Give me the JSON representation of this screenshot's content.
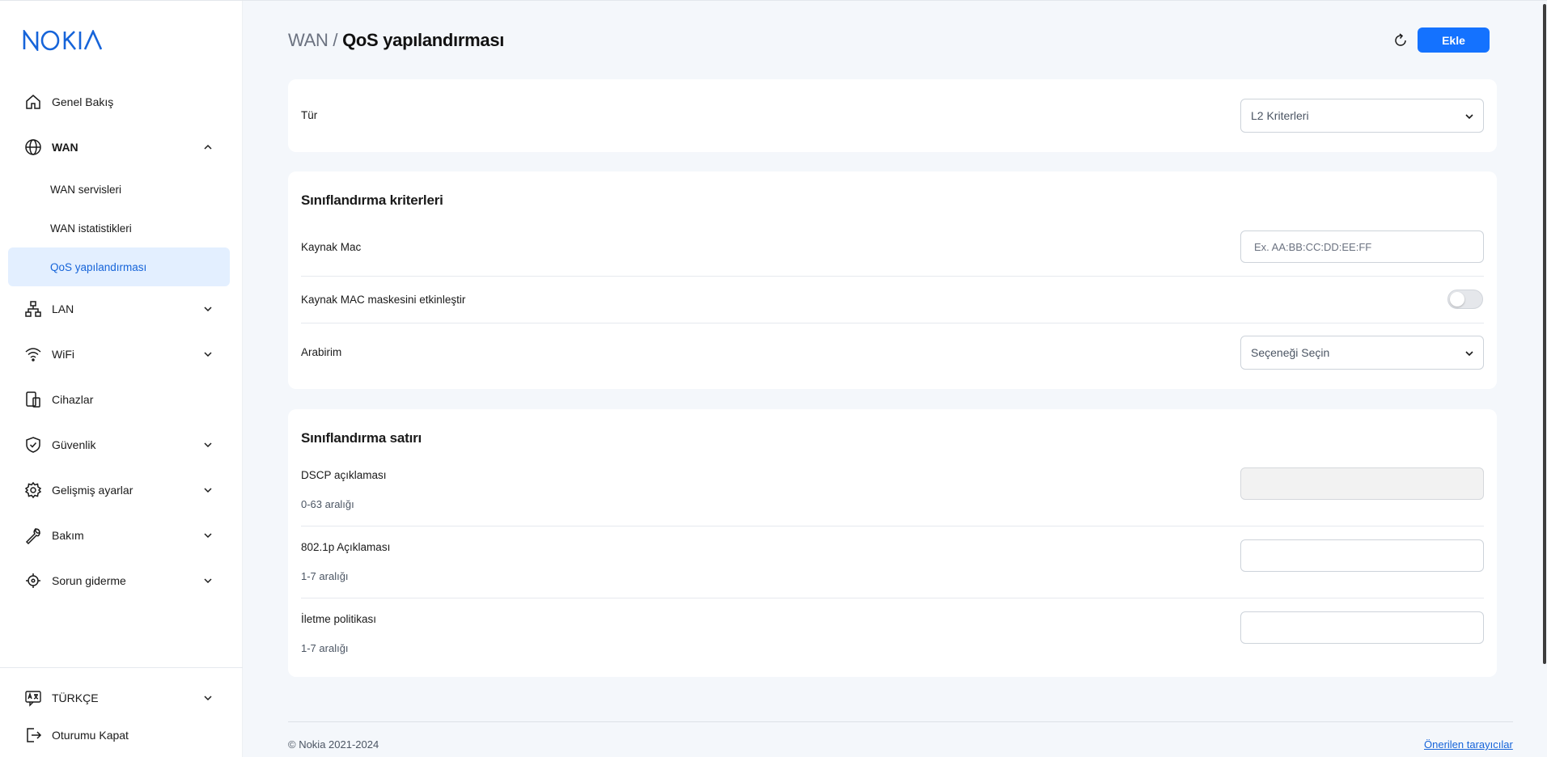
{
  "brand": {
    "logo_text": "NOKIA",
    "accent": "#1472ff",
    "active_bg": "#e3efff"
  },
  "sidebar": {
    "items": [
      {
        "label": "Genel Bakış",
        "icon": "home-icon"
      },
      {
        "label": "WAN",
        "icon": "globe-icon",
        "expanded": true
      },
      {
        "label": "LAN",
        "icon": "network-icon"
      },
      {
        "label": "WiFi",
        "icon": "wifi-icon"
      },
      {
        "label": "Cihazlar",
        "icon": "devices-icon"
      },
      {
        "label": "Güvenlik",
        "icon": "shield-icon"
      },
      {
        "label": "Gelişmiş ayarlar",
        "icon": "gear-icon"
      },
      {
        "label": "Bakım",
        "icon": "wrench-icon"
      },
      {
        "label": "Sorun giderme",
        "icon": "crosshair-icon"
      }
    ],
    "wan_sub": [
      {
        "label": "WAN servisleri"
      },
      {
        "label": "WAN istatistikleri"
      },
      {
        "label": "QoS yapılandırması",
        "active": true
      }
    ],
    "language": "TÜRKÇE",
    "logout": "Oturumu Kapat"
  },
  "header": {
    "breadcrumb_parent": "WAN /",
    "breadcrumb_current": "QoS yapılandırması",
    "add_label": "Ekle"
  },
  "type_card": {
    "label": "Tür",
    "value": "L2 Kriterleri"
  },
  "criteria": {
    "title": "Sınıflandırma kriterleri",
    "source_mac_label": "Kaynak Mac",
    "source_mac_placeholder": "Ex. AA:BB:CC:DD:EE:FF",
    "mac_mask_label": "Kaynak MAC maskesini etkinleştir",
    "mac_mask_enabled": false,
    "interface_label": "Arabirim",
    "interface_value": "Seçeneği Seçin"
  },
  "classification_row": {
    "title": "Sınıflandırma satırı",
    "dscp_label": "DSCP açıklaması",
    "dscp_hint": "0-63 aralığı",
    "dot1p_label": "802.1p Açıklaması",
    "dot1p_hint": "1-7 aralığı",
    "forward_label": "İletme politikası",
    "forward_hint": "1-7 aralığı"
  },
  "footer": {
    "copyright": "© Nokia 2021-2024",
    "browsers_link": "Önerilen tarayıcılar"
  }
}
